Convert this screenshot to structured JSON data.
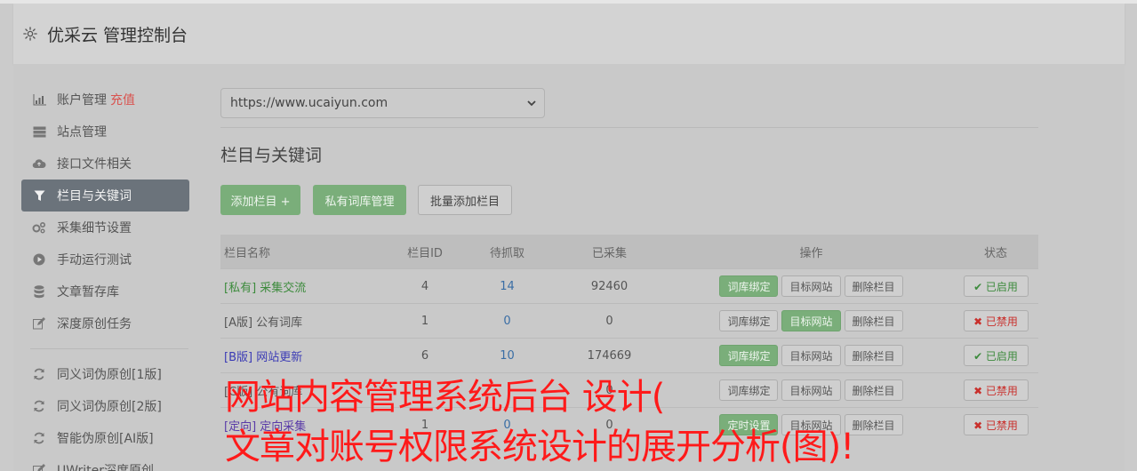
{
  "app": {
    "title": "优采云 管理控制台"
  },
  "sidebar": {
    "items": [
      {
        "label": "账户管理",
        "extra": "充值",
        "icon": "bar-chart-icon"
      },
      {
        "label": "站点管理",
        "icon": "server-icon"
      },
      {
        "label": "接口文件相关",
        "icon": "cloud-upload-icon"
      },
      {
        "label": "栏目与关键词",
        "icon": "filter-icon",
        "active": true
      },
      {
        "label": "采集细节设置",
        "icon": "gears-icon"
      },
      {
        "label": "手动运行测试",
        "icon": "play-circle-icon"
      },
      {
        "label": "文章暂存库",
        "icon": "database-icon"
      },
      {
        "label": "深度原创任务",
        "icon": "edit-icon"
      }
    ],
    "items2": [
      {
        "label": "同义词伪原创[1版]",
        "icon": "refresh-icon"
      },
      {
        "label": "同义词伪原创[2版]",
        "icon": "refresh-icon"
      },
      {
        "label": "智能伪原创[AI版]",
        "icon": "refresh-icon"
      },
      {
        "label": "UWriter深度原创",
        "icon": "edit-icon"
      }
    ]
  },
  "main": {
    "site_select": "https://www.ucaiyun.com",
    "section_title": "栏目与关键词",
    "buttons": {
      "add_column": "添加栏目 +",
      "private_lib": "私有词库管理",
      "batch_add": "批量添加栏目"
    },
    "table": {
      "headers": [
        "栏目名称",
        "栏目ID",
        "待抓取",
        "已采集",
        "操作",
        "状态"
      ],
      "ops": {
        "bind": "词库绑定",
        "target": "目标网站",
        "delete": "删除栏目",
        "custom": "定时设置"
      },
      "rows": [
        {
          "name": "[私有] 采集交流",
          "id": "4",
          "pending": "14",
          "done": "92460",
          "state": "✔ 已启用"
        },
        {
          "name": "[A版] 公有词库",
          "id": "1",
          "pending": "0",
          "done": "0",
          "state": "✖ 已禁用"
        },
        {
          "name": "[B版] 网站更新",
          "id": "6",
          "pending": "10",
          "done": "174669",
          "state": "✔ 已启用"
        },
        {
          "name": "[C版] 公有词库",
          "id": "",
          "pending": "",
          "done": "0",
          "state": "✖ 已禁用"
        },
        {
          "name": "[定向] 定向采集",
          "id": "1",
          "pending": "0",
          "done": "0",
          "state": "✖ 已禁用"
        }
      ]
    }
  },
  "overlay": {
    "line1": "网站内容管理系统后台 设计(",
    "line2": "文章对账号权限系统设计的展开分析(图)!"
  }
}
